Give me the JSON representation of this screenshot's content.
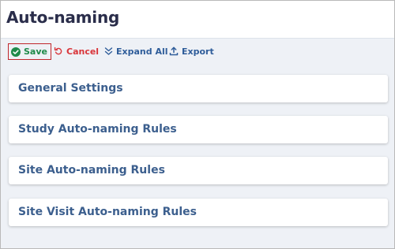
{
  "page": {
    "title": "Auto-naming"
  },
  "toolbar": {
    "save_label": "Save",
    "save_icon": "check-circle-icon",
    "cancel_label": "Cancel",
    "cancel_icon": "undo-icon",
    "expand_label": "Expand All",
    "expand_icon": "double-chevron-down-icon",
    "export_label": "Export",
    "export_icon": "upload-icon",
    "colors": {
      "save": "#1e8a4a",
      "save_border": "#c0262b",
      "cancel": "#d9353a",
      "link": "#2f5d9a"
    }
  },
  "sections": [
    {
      "label": "General Settings"
    },
    {
      "label": "Study Auto-naming Rules"
    },
    {
      "label": "Site Auto-naming Rules"
    },
    {
      "label": "Site Visit Auto-naming Rules"
    }
  ]
}
